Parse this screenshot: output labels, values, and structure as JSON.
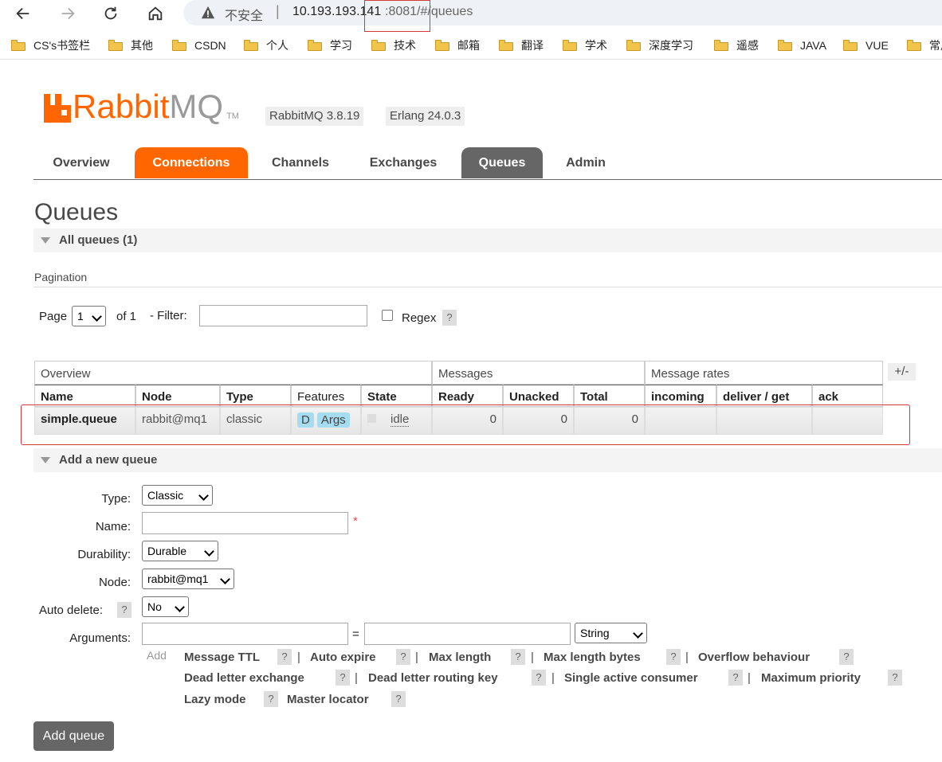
{
  "browser": {
    "insecure_label": "不安全",
    "separator": "|",
    "url_host": "10.193.193.141",
    "url_rest": ":8081/#/queues",
    "bookmarks": [
      "CS's书签栏",
      "其他",
      "CSDN",
      "个人",
      "学习",
      "技术",
      "邮箱",
      "翻译",
      "学术",
      "深度学习",
      "遥感",
      "JAVA",
      "VUE",
      "常用"
    ]
  },
  "header": {
    "logo_rabbit": "Rabbit",
    "logo_mq": "MQ",
    "logo_tm": "TM",
    "rabbitmq_version": "RabbitMQ 3.8.19",
    "erlang_version": "Erlang 24.0.3"
  },
  "tabs": [
    "Overview",
    "Connections",
    "Channels",
    "Exchanges",
    "Queues",
    "Admin"
  ],
  "page": {
    "title": "Queues",
    "all_queues_label": "All queues (1)",
    "pagination_label": "Pagination",
    "page_label": "Page",
    "page_value": "1",
    "of_label": "of 1",
    "filter_label": "- Filter:",
    "regex_label": "Regex",
    "help_mark": "?"
  },
  "table": {
    "group_headers": [
      "Overview",
      "Messages",
      "Message rates"
    ],
    "plus_minus": "+/-",
    "columns": [
      "Name",
      "Node",
      "Type",
      "Features",
      "State",
      "Ready",
      "Unacked",
      "Total",
      "incoming",
      "deliver / get",
      "ack"
    ],
    "rows": [
      {
        "name": "simple.queue",
        "node": "rabbit@mq1",
        "type": "classic",
        "features": [
          "D",
          "Args"
        ],
        "state": "idle",
        "ready": "0",
        "unacked": "0",
        "total": "0",
        "incoming": "",
        "deliver_get": "",
        "ack": ""
      }
    ]
  },
  "add_queue": {
    "section_label": "Add a new queue",
    "type_label": "Type:",
    "type_value": "Classic",
    "name_label": "Name:",
    "required_mark": "*",
    "durability_label": "Durability:",
    "durability_value": "Durable",
    "node_label": "Node:",
    "node_value": "rabbit@mq1",
    "auto_delete_label": "Auto delete:",
    "auto_delete_value": "No",
    "arguments_label": "Arguments:",
    "equals": "=",
    "arg_type_value": "String",
    "add_label": "Add",
    "arg_helpers": [
      "Message TTL",
      "Auto expire",
      "Max length",
      "Max length bytes",
      "Overflow behaviour",
      "Dead letter exchange",
      "Dead letter routing key",
      "Single active consumer",
      "Maximum priority",
      "Lazy mode",
      "Master locator"
    ],
    "pipe": "|",
    "submit_label": "Add queue"
  }
}
